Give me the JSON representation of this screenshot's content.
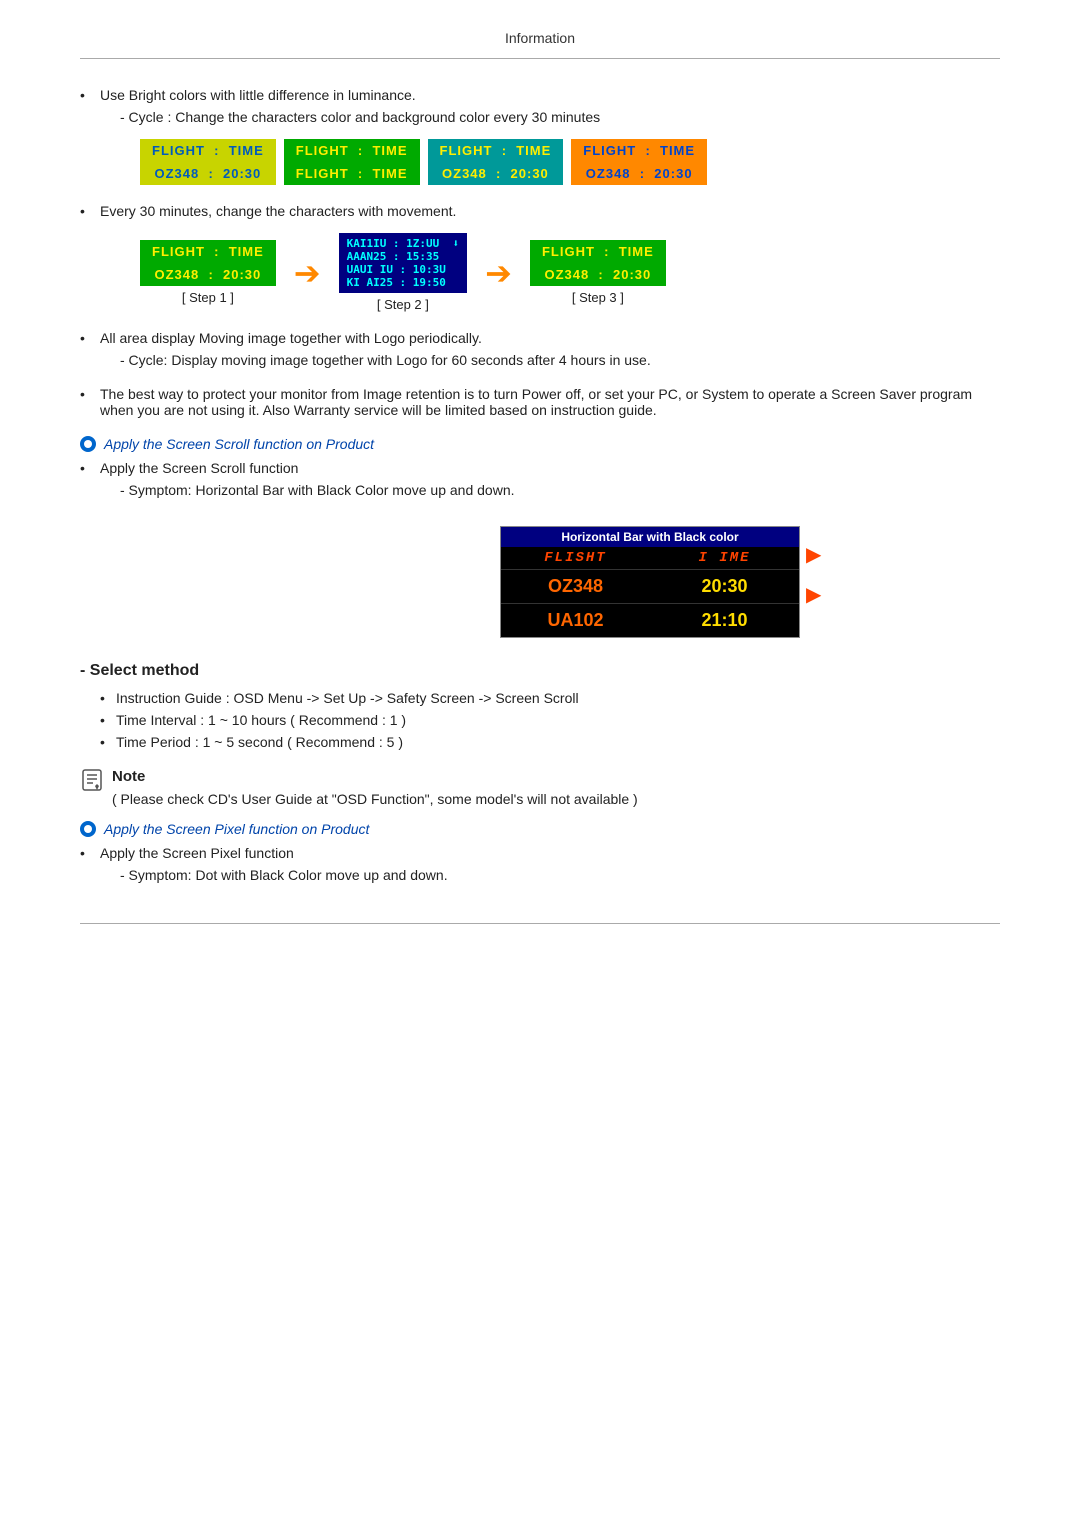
{
  "header": {
    "title": "Information"
  },
  "bullets": [
    {
      "id": "bright-colors",
      "text": "Use Bright colors with little difference in luminance.",
      "sub": "- Cycle : Change the characters color and background color every 30 minutes"
    },
    {
      "id": "every-30",
      "text": "Every 30 minutes, change the characters with movement."
    },
    {
      "id": "all-area",
      "text": "All area display Moving image together with Logo periodically.",
      "sub": "- Cycle: Display moving image together with Logo for 60 seconds after 4 hours in use."
    },
    {
      "id": "best-way",
      "text": "The best way to protect your monitor from Image retention is to turn Power off, or set your PC, or System to operate a Screen Saver program when you are not using it. Also Warranty service will be limited based on instruction guide."
    }
  ],
  "apply_screen_scroll": "Apply the Screen Scroll function on Product",
  "apply_screen_pixel": "Apply the Screen Pixel function on Product",
  "scroll_bullet": "Apply the Screen Scroll function",
  "scroll_symptom": "- Symptom: Horizontal Bar with Black Color move up and down.",
  "pixel_bullet": "Apply the Screen Pixel function",
  "pixel_symptom": "- Symptom: Dot with Black Color move up and down.",
  "hbar_title": "Horizontal Bar with Black color",
  "hbar_header": [
    "FLIGHT",
    "TIME"
  ],
  "hbar_rows": [
    [
      "OZ348",
      "20:30"
    ],
    [
      "UA102",
      "21:10"
    ]
  ],
  "select_method": {
    "title": "- Select method",
    "items": [
      "Instruction Guide : OSD Menu -> Set Up -> Safety Screen -> Screen Scroll",
      "Time Interval : 1 ~ 10 hours ( Recommend : 1 )",
      "Time Period : 1 ~ 5 second ( Recommend : 5 )"
    ]
  },
  "note_label": "Note",
  "note_text": "( Please check CD's User Guide at \"OSD Function\", some model's will not available )",
  "flight_demos": [
    {
      "top_text": "FLIGHT  :  TIME",
      "top_class": "fc-yellow-green",
      "bot_text": "OZ348   :  20:30",
      "bot_class": "fc-yellow-green"
    },
    {
      "top_text": "FLIGHT  :  TIME",
      "top_class": "fc-green-yellow",
      "bot_text": "FLIGHT  :  TIME",
      "bot_class": "fc-green-yellow"
    },
    {
      "top_text": "FLIGHT  :  TIME",
      "top_class": "fc-teal-yellow",
      "bot_text": "OZ348   :  20:30",
      "bot_class": "fc-teal-yellow"
    },
    {
      "top_text": "FLIGHT  :  TIME",
      "top_class": "fc-orange-blue",
      "bot_text": "OZ348   :  20:30",
      "bot_class": "fc-orange-blue"
    }
  ],
  "steps": [
    {
      "label": "[ Step 1 ]",
      "top_text": "FLIGHT  :  TIME",
      "top_class": "fc-green-yellow",
      "bot_text": "OZ348   :  20:30",
      "bot_class": "fc-green-yellow"
    },
    {
      "label": "[ Step 2 ]",
      "scrambled_top": "KAI1IU : 1Z:UU",
      "scrambled_bot1": "AAAN25 : 15:35",
      "scrambled_bot2": "UAUI IU : 10:3U",
      "scrambled_bot3": "KI AI25 : 19:50"
    },
    {
      "label": "[ Step 3 ]",
      "top_text": "FLIGHT  :  TIME",
      "top_class": "fc-green-yellow",
      "bot_text": "OZ348   :  20:30",
      "bot_class": "fc-green-yellow"
    }
  ]
}
